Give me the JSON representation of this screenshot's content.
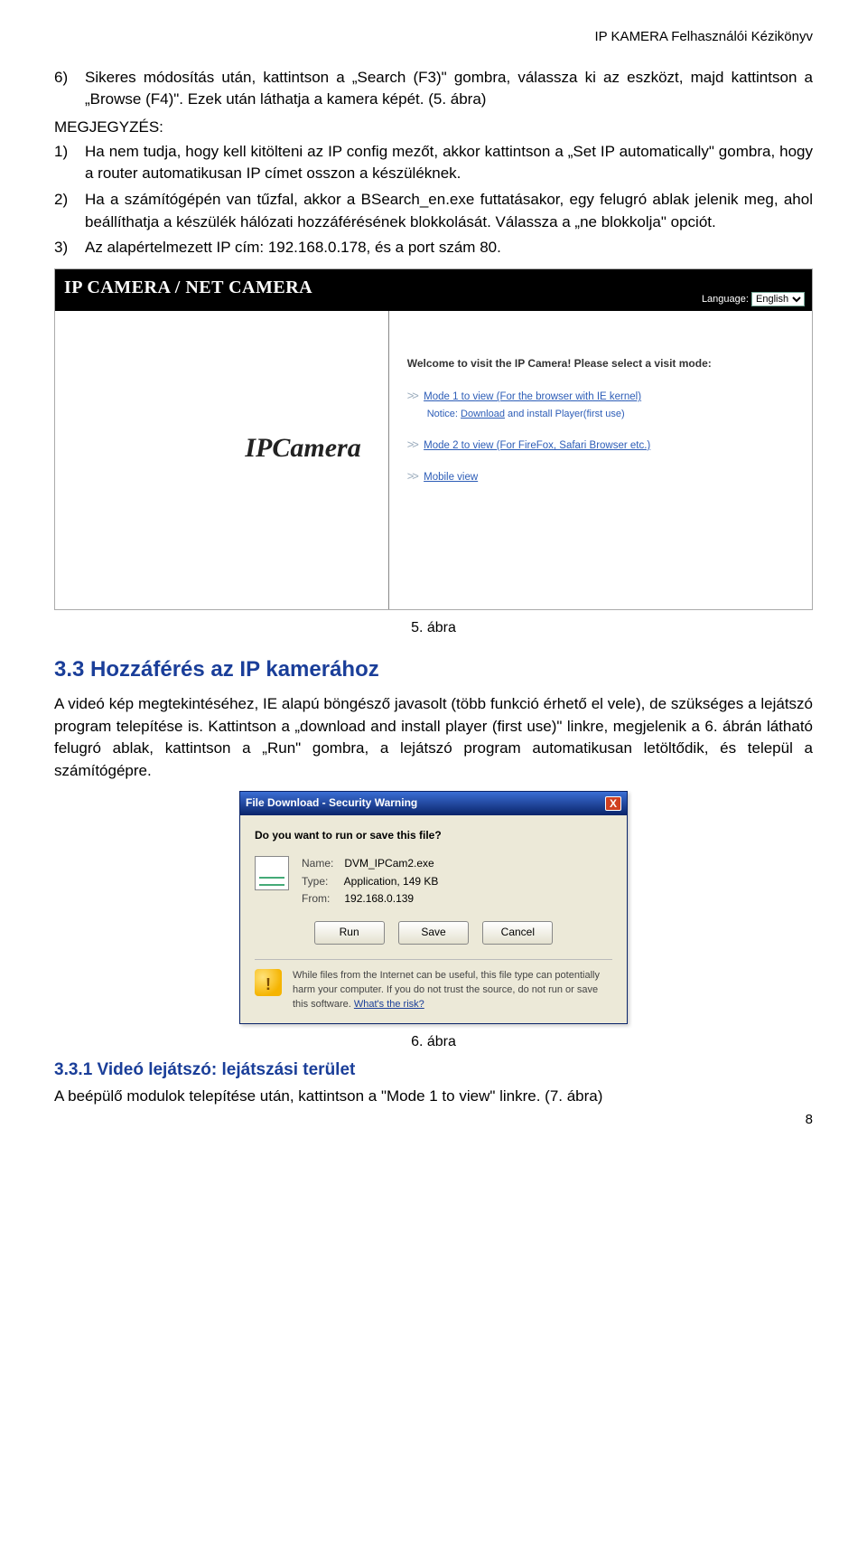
{
  "header": "IP KAMERA Felhasználói Kézikönyv",
  "body": {
    "step6_num": "6)",
    "step6": "Sikeres módosítás után, kattintson a „Search (F3)\" gombra, válassza ki az eszközt, majd kattintson a „Browse (F4)\". Ezek után láthatja a kamera képét. (5. ábra)",
    "notes_label": "MEGJEGYZÉS:",
    "note1_num": "1)",
    "note1": "Ha nem tudja, hogy kell kitölteni az IP config mezőt, akkor kattintson a „Set IP automatically\" gombra, hogy a router automatikusan IP címet osszon a készüléknek.",
    "note2_num": "2)",
    "note2": "Ha a számítógépén van tűzfal, akkor a BSearch_en.exe futtatásakor, egy felugró ablak jelenik meg, ahol beállíthatja a készülék hálózati hozzáférésének blokkolását. Válassza a „ne blokkolja\" opciót.",
    "note3_num": "3)",
    "note3": "Az alapértelmezett IP cím: 192.168.0.178, és a port szám 80."
  },
  "fig5": {
    "title": "IP CAMERA / NET CAMERA",
    "language_label": "Language:",
    "language_value": "English",
    "logo": "IPCamera",
    "welcome": "Welcome to visit the IP Camera! Please select a visit mode:",
    "mode1": "Mode 1 to view (For the browser with IE kernel)",
    "notice_prefix": "Notice:",
    "notice_download": "Download",
    "notice_rest": "and install Player(first use)",
    "mode2": "Mode 2 to view (For FireFox, Safari Browser etc.)",
    "mode3": "Mobile view",
    "arrow": ">>"
  },
  "fig5_caption": "5. ábra",
  "section33_title": "3.3 Hozzáférés az IP kamerához",
  "section33_body": "A videó kép megtekintéséhez, IE alapú böngésző javasolt (több funkció érhető el vele), de szükséges a lejátszó program telepítése is. Kattintson a „download and install player (first use)\" linkre, megjelenik a 6. ábrán látható felugró ablak, kattintson a „Run\" gombra, a lejátszó program automatikusan letöltődik, és települ a számítógépre.",
  "fig6": {
    "title": "File Download - Security Warning",
    "question": "Do you want to run or save this file?",
    "name_lbl": "Name:",
    "name_val": "DVM_IPCam2.exe",
    "type_lbl": "Type:",
    "type_val": "Application, 149 KB",
    "from_lbl": "From:",
    "from_val": "192.168.0.139",
    "btn_run": "Run",
    "btn_save": "Save",
    "btn_cancel": "Cancel",
    "warn": "While files from the Internet can be useful, this file type can potentially harm your computer. If you do not trust the source, do not run or save this software.",
    "risk": "What's the risk?"
  },
  "fig6_caption": "6. ábra",
  "section331_title": "3.3.1 Videó lejátszó: lejátszási terület",
  "section331_body": "A beépülő modulok telepítése után, kattintson a \"Mode 1 to view\" linkre. (7. ábra)",
  "page_number": "8"
}
